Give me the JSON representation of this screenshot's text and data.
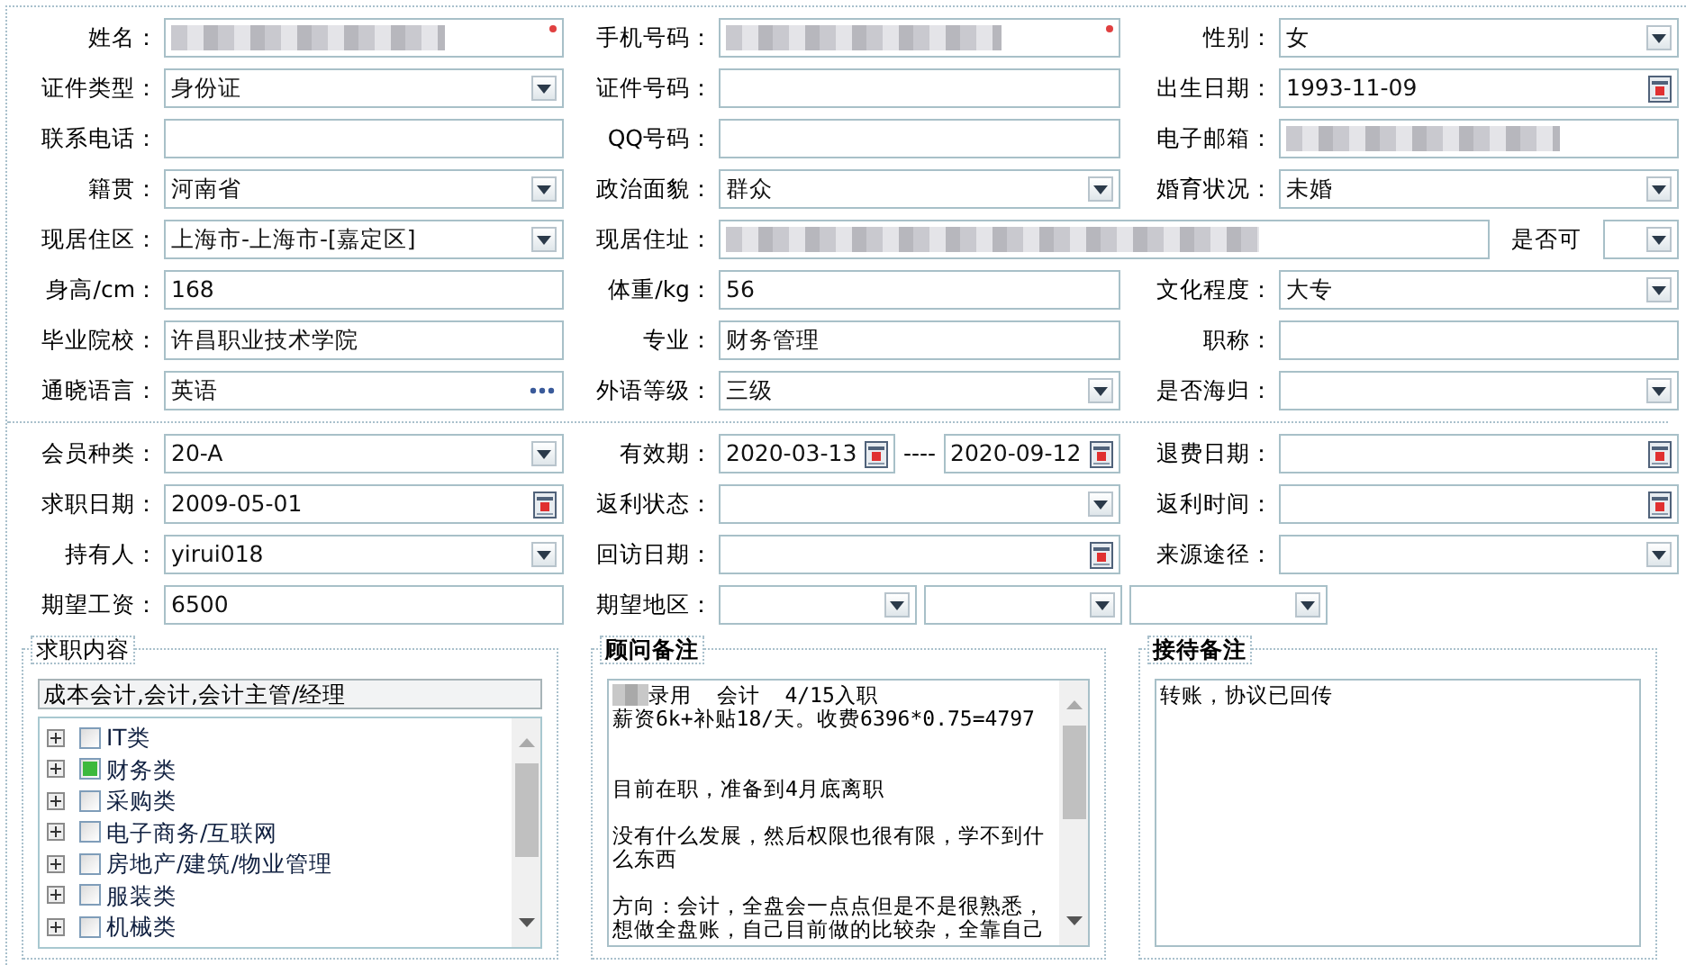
{
  "personal_rows": [
    {
      "groups": [
        {
          "label": "姓名：",
          "fields": [
            {
              "kind": "text",
              "redacted": true,
              "required": true
            }
          ]
        },
        {
          "label": "手机号码：",
          "fields": [
            {
              "kind": "text",
              "redacted": true,
              "required": true
            }
          ]
        },
        {
          "label": "性别：",
          "fields": [
            {
              "kind": "select",
              "value": "女"
            }
          ]
        }
      ]
    },
    {
      "groups": [
        {
          "label": "证件类型：",
          "fields": [
            {
              "kind": "select",
              "value": "身份证"
            }
          ]
        },
        {
          "label": "证件号码：",
          "fields": [
            {
              "kind": "text"
            }
          ]
        },
        {
          "label": "出生日期：",
          "fields": [
            {
              "kind": "date",
              "value": "1993-11-09"
            }
          ]
        }
      ]
    },
    {
      "groups": [
        {
          "label": "联系电话：",
          "fields": [
            {
              "kind": "text"
            }
          ]
        },
        {
          "label": "QQ号码：",
          "fields": [
            {
              "kind": "text"
            }
          ]
        },
        {
          "label": "电子邮箱：",
          "fields": [
            {
              "kind": "text",
              "redacted": true
            }
          ]
        }
      ]
    },
    {
      "groups": [
        {
          "label": "籍贯：",
          "fields": [
            {
              "kind": "select",
              "value": "河南省"
            }
          ]
        },
        {
          "label": "政治面貌：",
          "fields": [
            {
              "kind": "select",
              "value": "群众"
            }
          ]
        },
        {
          "label": "婚育状况：",
          "fields": [
            {
              "kind": "select",
              "value": "未婚"
            }
          ]
        }
      ]
    },
    {
      "groups": [
        {
          "label": "现居住区：",
          "fields": [
            {
              "kind": "select",
              "value": "上海市-上海市-[嘉定区]"
            }
          ]
        },
        {
          "label": "现居住址：",
          "fields": [
            {
              "kind": "text",
              "redacted": true
            },
            {
              "kind": "inline-label",
              "value": "是否可"
            },
            {
              "kind": "select"
            }
          ]
        }
      ]
    },
    {
      "groups": [
        {
          "label": "身高/cm：",
          "fields": [
            {
              "kind": "text",
              "value": "168"
            }
          ]
        },
        {
          "label": "体重/kg：",
          "fields": [
            {
              "kind": "text",
              "value": "56"
            }
          ]
        },
        {
          "label": "文化程度：",
          "fields": [
            {
              "kind": "select",
              "value": "大专"
            }
          ]
        }
      ]
    },
    {
      "groups": [
        {
          "label": "毕业院校：",
          "fields": [
            {
              "kind": "text",
              "value": "许昌职业技术学院"
            }
          ]
        },
        {
          "label": "专业：",
          "fields": [
            {
              "kind": "text",
              "value": "财务管理"
            }
          ]
        },
        {
          "label": "职称：",
          "fields": [
            {
              "kind": "text"
            }
          ]
        }
      ]
    },
    {
      "groups": [
        {
          "label": "通晓语言：",
          "fields": [
            {
              "kind": "lookup",
              "value": "英语"
            }
          ]
        },
        {
          "label": "外语等级：",
          "fields": [
            {
              "kind": "select",
              "value": "三级"
            }
          ]
        },
        {
          "label": "是否海归：",
          "fields": [
            {
              "kind": "select"
            }
          ]
        }
      ]
    }
  ],
  "member_rows": [
    {
      "groups": [
        {
          "label": "会员种类：",
          "fields": [
            {
              "kind": "select",
              "value": "20-A"
            }
          ]
        },
        {
          "label": "有效期：",
          "fields": [
            {
              "kind": "date",
              "value": "2020-03-13"
            },
            {
              "kind": "dash",
              "value": "----"
            },
            {
              "kind": "date",
              "value": "2020-09-12"
            }
          ]
        },
        {
          "label": "退费日期：",
          "fields": [
            {
              "kind": "date"
            }
          ]
        }
      ]
    },
    {
      "groups": [
        {
          "label": "求职日期：",
          "fields": [
            {
              "kind": "date",
              "value": "2009-05-01"
            }
          ]
        },
        {
          "label": "返利状态：",
          "fields": [
            {
              "kind": "select"
            }
          ]
        },
        {
          "label": "返利时间：",
          "fields": [
            {
              "kind": "date"
            }
          ]
        }
      ]
    },
    {
      "groups": [
        {
          "label": "持有人：",
          "fields": [
            {
              "kind": "select",
              "value": "yirui018"
            }
          ]
        },
        {
          "label": "回访日期：",
          "fields": [
            {
              "kind": "date"
            }
          ]
        },
        {
          "label": "来源途径：",
          "fields": [
            {
              "kind": "select"
            }
          ]
        }
      ]
    },
    {
      "groups": [
        {
          "label": "期望工资：",
          "fields": [
            {
              "kind": "text",
              "value": "6500"
            }
          ]
        },
        {
          "label": "期望地区：",
          "fields": [
            {
              "kind": "select"
            },
            {
              "kind": "select"
            },
            {
              "kind": "select"
            }
          ]
        }
      ]
    }
  ],
  "job_panel": {
    "legend": "求职内容",
    "summary": "成本会计,会计,会计主管/经理",
    "tree": [
      {
        "label": "IT类",
        "checked": false,
        "expanded": false
      },
      {
        "label": "财务类",
        "checked": true,
        "expanded": false
      },
      {
        "label": "采购类",
        "checked": false,
        "expanded": false
      },
      {
        "label": "电子商务/互联网",
        "checked": false,
        "expanded": false
      },
      {
        "label": "房地产/建筑/物业管理",
        "checked": false,
        "expanded": false
      },
      {
        "label": "服装类",
        "checked": false,
        "expanded": false
      },
      {
        "label": "机械类",
        "checked": false,
        "expanded": false
      }
    ]
  },
  "advisor_panel": {
    "legend": "顾问备注",
    "redacted_prefix": true,
    "paragraphs": [
      [
        "录用  会计  4/15入职",
        "薪资6k+补贴18/天。收费6396*0.75=4797"
      ],
      [
        "目前在职，准备到4月底离职"
      ],
      [
        "没有什么发展，然后权限也很有限，学不到什么东西"
      ],
      [
        "方向：会计，全盘会一点点但是不是很熟悉，想做全盘账，自己目前做的比较杂，全靠自己"
      ]
    ]
  },
  "reception_panel": {
    "legend": "接待备注",
    "value": "转账，协议已回传"
  }
}
